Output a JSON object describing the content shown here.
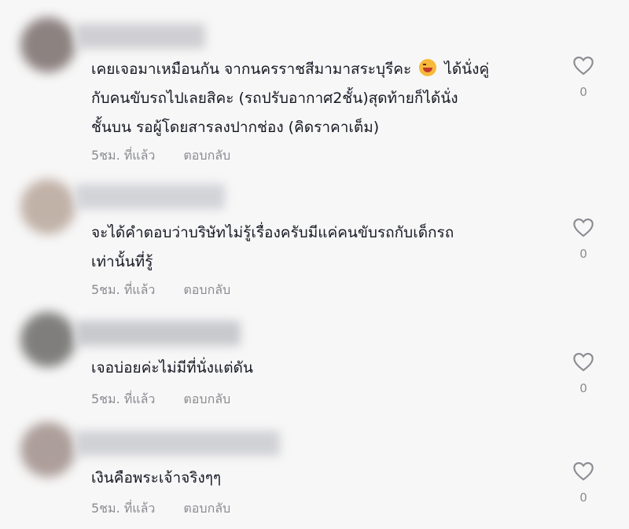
{
  "comments": [
    {
      "text_before_emoji": "เคยเจอมาเหมือนกัน จากนครราชสีมามาสระบุรีคะ ",
      "emoji": "laughing-face-emoji",
      "text_after_emoji": " ได้นั่งคู่\nกับคนขับรถไปเลยสิคะ (รถปรับอากาศ2ชั้น)สุดท้ายก็ได้นั่ง\nชั้นบน รอผู้โดยสารลงปากช่อง (คิดราคาเต็ม)",
      "time": "5ชม. ที่แล้ว",
      "reply": "ตอบกลับ",
      "likes": "0",
      "avatar_color": "#7a6e6c",
      "name_color": "#cfcfd3"
    },
    {
      "text": "จะได้คำตอบว่าบริษัทไม่รู้เรื่องครับมีแค่คนขับรถกับเด็กรถ\nเท่านั้นที่รู้",
      "time": "5ชม. ที่แล้ว",
      "reply": "ตอบกลับ",
      "likes": "0",
      "avatar_color": "#b8a69a",
      "name_color": "#d2d3d8"
    },
    {
      "text": "เจอบ่อยค่ะไม่มีที่นั่งแต่ดัน",
      "time": "5ชม. ที่แล้ว",
      "reply": "ตอบกลับ",
      "likes": "0",
      "avatar_color": "#6b6a68",
      "name_color": "#c8c9cd"
    },
    {
      "text": "เงินคือพระเจ้าจริงๆๆ",
      "time": "5ชม. ที่แล้ว",
      "reply": "ตอบกลับ",
      "likes": "0",
      "avatar_color": "#a08f8a",
      "name_color": "#d0d1d5"
    }
  ],
  "colors": {
    "text": "#161823",
    "meta": "#8a8b91",
    "heart_outline": "#8a8b91"
  }
}
